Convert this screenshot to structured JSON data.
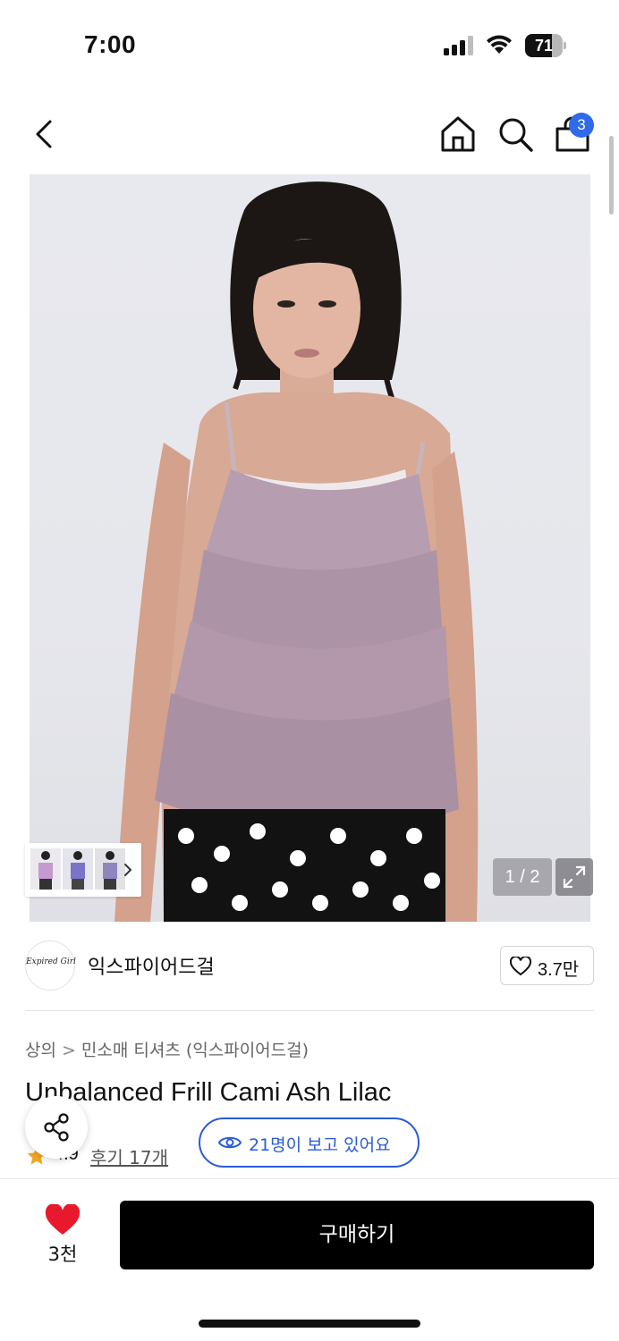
{
  "status_bar": {
    "time": "7:00",
    "battery_level": "71",
    "battery_fraction": 0.71
  },
  "nav": {
    "back_icon": "chevron-left-icon",
    "home_icon": "home-icon",
    "search_icon": "search-icon",
    "cart_icon": "shopping-bag-icon",
    "cart_badge": "3"
  },
  "gallery": {
    "page_counter": "1 / 2",
    "thumb_arrow_icon": "chevron-right-icon",
    "expand_icon": "expand-icon"
  },
  "brand": {
    "logo_text": "Expired Girl",
    "name": "익스파이어드걸",
    "like_icon": "heart-outline-icon",
    "like_count": "3.7만"
  },
  "product": {
    "breadcrumb": [
      "상의",
      "민소매 티셔츠 (익스파이어드걸)"
    ],
    "breadcrumb_separator": ">",
    "title": "Unbalanced Frill Cami Ash Lilac",
    "rating": "4.9",
    "reviews": "후기 17개",
    "viewers": "21명이 보고 있어요"
  },
  "bottom_bar": {
    "wish_count": "3천",
    "buy_label": "구매하기"
  },
  "colors": {
    "accent_blue": "#2a5bd7",
    "badge_blue": "#2f6be8",
    "heart_red": "#e8192c",
    "star_orange": "#f5a623"
  }
}
